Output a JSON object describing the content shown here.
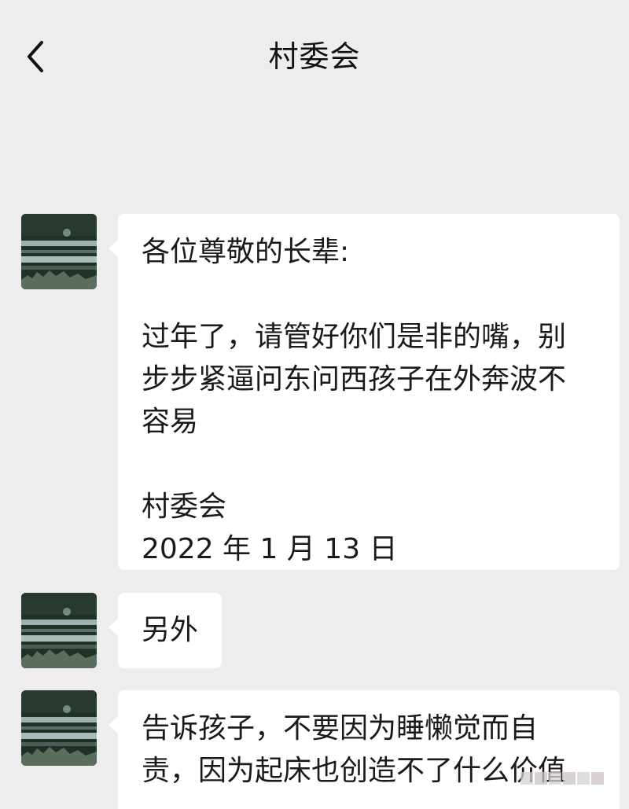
{
  "header": {
    "title": "村委会",
    "back_icon": "chevron-left-icon"
  },
  "conversation": {
    "messages": [
      {
        "avatar_icon": "landscape-avatar-icon",
        "lines": [
          "各位尊敬的长辈:",
          "",
          "过年了，请管好你们是非的嘴，别",
          "步步紧逼问东问西孩子在外奔波不",
          "容易",
          "",
          "村委会",
          "2022 年 1 月 13 日"
        ]
      },
      {
        "avatar_icon": "landscape-avatar-icon",
        "lines": [
          "另外"
        ]
      },
      {
        "avatar_icon": "landscape-avatar-icon",
        "lines": [
          "告诉孩子，不要因为睡懒觉而自",
          "责，因为起床也创造不了什么价值"
        ]
      }
    ]
  },
  "colors": {
    "background": "#ededed",
    "bubble": "#ffffff",
    "text": "#1a1a1a"
  }
}
